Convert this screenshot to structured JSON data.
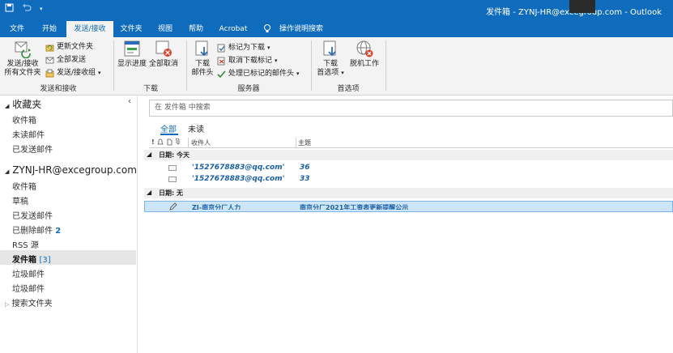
{
  "window": {
    "title": "发件箱 - ZYNJ-HR@excegroup.com - Outlook"
  },
  "tabs": [
    "文件",
    "开始",
    "发送/接收",
    "文件夹",
    "视图",
    "帮助",
    "Acrobat",
    "操作说明搜索"
  ],
  "ribbon": {
    "send_receive_group": {
      "label": "发送和接收",
      "send_all_label": "发送/接收\n所有文件夹",
      "update_folder": "更新文件夹",
      "send_all": "全部发送",
      "groups_dropdown": "发送/接收组"
    },
    "download_group": {
      "label": "下载",
      "show_progress": "显示进度",
      "cancel_all": "全部取消"
    },
    "server_group": {
      "label": "服务器",
      "download_headers": "下载\n邮件头",
      "mark_download": "标记为下载",
      "unmark_download": "取消下载标记",
      "process_marked": "处理已标记的邮件头"
    },
    "preferences_group": {
      "label": "首选项",
      "download_prefs": "下载\n首选项",
      "work_offline": "脱机工作"
    }
  },
  "nav": {
    "favorites_header": "收藏夹",
    "favorites": [
      "收件箱",
      "未读邮件",
      "已发送邮件"
    ],
    "account": "ZYNJ-HR@excegroup.com",
    "folders": [
      {
        "label": "收件箱"
      },
      {
        "label": "草稿"
      },
      {
        "label": "已发送邮件"
      },
      {
        "label": "已删除邮件",
        "count": "2"
      },
      {
        "label": "RSS 源"
      },
      {
        "label": "发件箱",
        "count": "[3]"
      },
      {
        "label": "垃圾邮件"
      },
      {
        "label": "垃圾邮件"
      },
      {
        "label": "搜索文件夹"
      }
    ],
    "collapse_glyph": "‹"
  },
  "search": {
    "placeholder": "在 发件箱 中搜索"
  },
  "filters": {
    "all": "全部",
    "unread": "未读"
  },
  "columns": {
    "importance": "!",
    "recipient": "收件人",
    "subject": "主题"
  },
  "groups": {
    "today": "日期: 今天",
    "none": "日期: 无"
  },
  "messages": [
    {
      "to": "'1527678883@qq.com'",
      "subject": "36"
    },
    {
      "to": "'1527678883@qq.com'",
      "subject": "33"
    }
  ],
  "selected_message": {
    "to": "ZJ-南京分厂人力",
    "subject": "南京分厂2021年工资表更新提醒公示"
  },
  "colors": {
    "brand": "#0f6cbd",
    "selected_row": "#cde6f7",
    "message_text": "#1a5fa8"
  }
}
